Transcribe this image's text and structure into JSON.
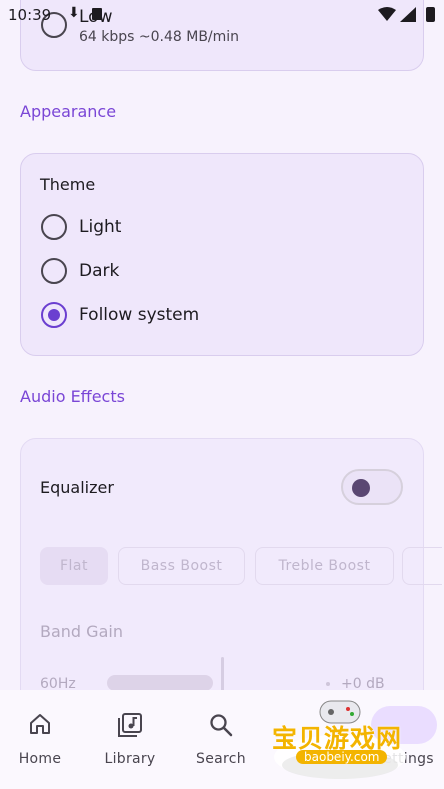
{
  "status_bar": {
    "time": "10:39"
  },
  "audio_quality": {
    "option_label": "Low",
    "option_detail": "64 kbps  ~0.48 MB/min"
  },
  "appearance": {
    "section_title": "Appearance",
    "card_title": "Theme",
    "options": [
      {
        "label": "Light",
        "selected": false
      },
      {
        "label": "Dark",
        "selected": false
      },
      {
        "label": "Follow system",
        "selected": true
      }
    ]
  },
  "audio_effects": {
    "section_title": "Audio Effects",
    "equalizer_label": "Equalizer",
    "equalizer_enabled": false,
    "presets": [
      "Flat",
      "Bass Boost",
      "Treble Boost"
    ],
    "selected_preset": "Flat",
    "band_gain_title": "Band Gain",
    "bands": [
      {
        "freq": "60Hz",
        "gain": "+0 dB"
      }
    ]
  },
  "bottom_nav": {
    "items": [
      {
        "label": "Home",
        "icon": "home-icon"
      },
      {
        "label": "Library",
        "icon": "library-icon"
      },
      {
        "label": "Search",
        "icon": "search-icon"
      },
      {
        "label": "Settings",
        "icon": "gear-icon"
      }
    ],
    "active": "Settings"
  },
  "watermark": {
    "text": "宝贝游戏网",
    "url": "baobeiy.com"
  },
  "colors": {
    "accent": "#6b3fd0",
    "section": "#7a46d6",
    "background": "#f7f2fd"
  }
}
